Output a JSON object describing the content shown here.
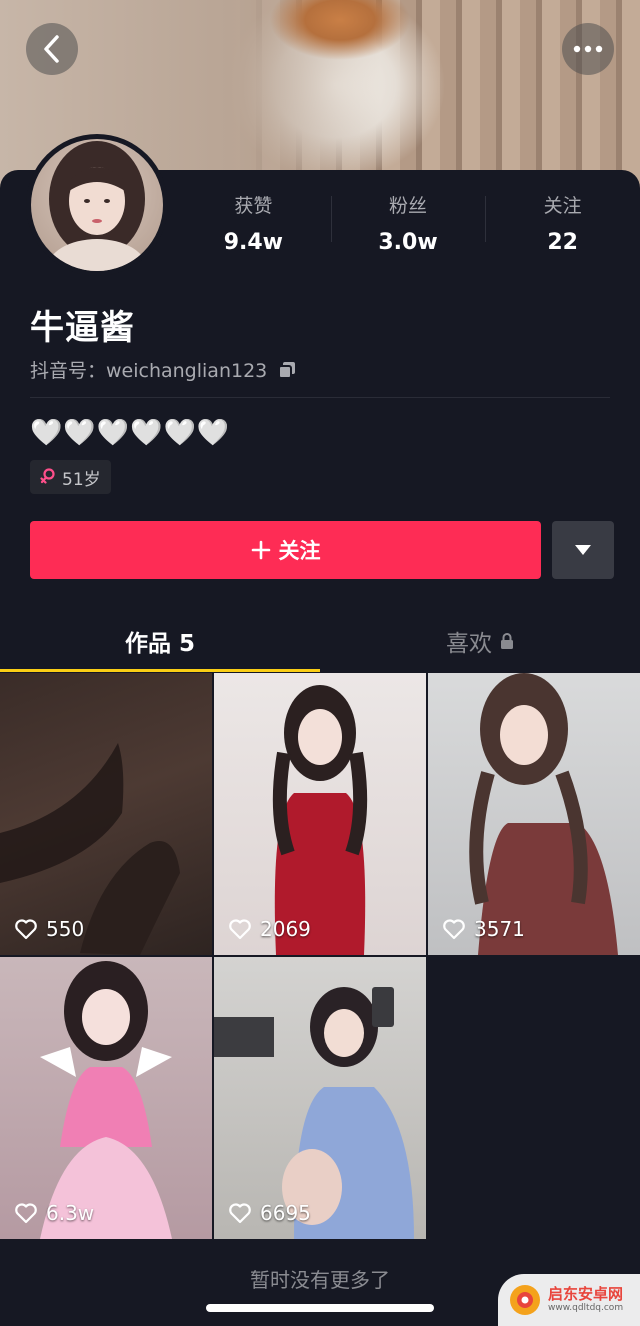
{
  "header": {
    "back_icon": "chevron-left-icon",
    "more_icon": "more-horizontal-icon"
  },
  "stats": [
    {
      "label": "获赞",
      "value": "9.4w"
    },
    {
      "label": "粉丝",
      "value": "3.0w"
    },
    {
      "label": "关注",
      "value": "22"
    }
  ],
  "profile": {
    "nickname": "牛逼酱",
    "id_label": "抖音号：weichanglian123",
    "bio": "🤍🤍🤍🤍🤍🤍",
    "age_tag": "51岁",
    "gender_icon": "female-icon"
  },
  "actions": {
    "follow_label": "关注",
    "more_dropdown_icon": "triangle-down-icon"
  },
  "tabs": [
    {
      "label": "作品 5",
      "active": true
    },
    {
      "label": "喜欢",
      "active": false,
      "locked": true
    }
  ],
  "videos": [
    {
      "likes": "550"
    },
    {
      "likes": "2069"
    },
    {
      "likes": "3571"
    },
    {
      "likes": "6.3w"
    },
    {
      "likes": "6695"
    }
  ],
  "footer": {
    "no_more": "暂时没有更多了"
  },
  "watermark": {
    "title": "启东安卓网",
    "url": "www.qdltdq.com"
  },
  "colors": {
    "background": "#161823",
    "follow_button": "#fe2c55",
    "tab_indicator": "#face15",
    "gender_accent": "#ff4f8b"
  }
}
